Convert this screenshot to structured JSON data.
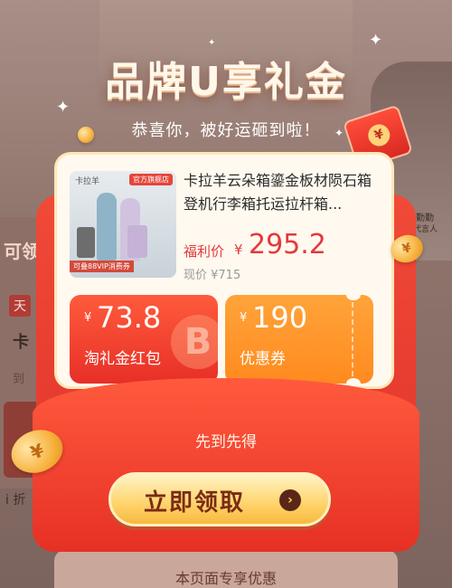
{
  "background": {
    "left_label": "可领",
    "left_tag": "天",
    "left_letter": "卡",
    "left_to": "到",
    "left_info": "i 折",
    "right_name": "蒋勤勤",
    "right_sub": "品牌代言人",
    "bottom_text": "本页面专享优惠"
  },
  "popup": {
    "headline": "品牌U享礼金",
    "subline": "恭喜你，被好运砸到啦！",
    "product": {
      "image_brand": "卡拉羊",
      "image_tag": "官方旗舰店",
      "image_badge": "可叠88VIP消费券",
      "title": "卡拉羊云朵箱鎏金板材陨石箱登机行李箱托运拉杆箱...",
      "price_label": "福利价",
      "price_currency": "¥",
      "price_value": "295.2",
      "original_price": "现价 ¥715"
    },
    "coupons": [
      {
        "currency": "¥",
        "amount": "73.8",
        "label": "淘礼金红包",
        "deco": "B"
      },
      {
        "currency": "¥",
        "amount": "190",
        "label": "优惠券"
      }
    ],
    "first_come": "先到先得",
    "claim_button": "立即领取",
    "claim_arrow": "›"
  },
  "colors": {
    "accent_red": "#e4393c",
    "envelope_red": "#f04a38",
    "button_gold": "#ffd36b",
    "coupon_orange": "#ff8a1f"
  }
}
